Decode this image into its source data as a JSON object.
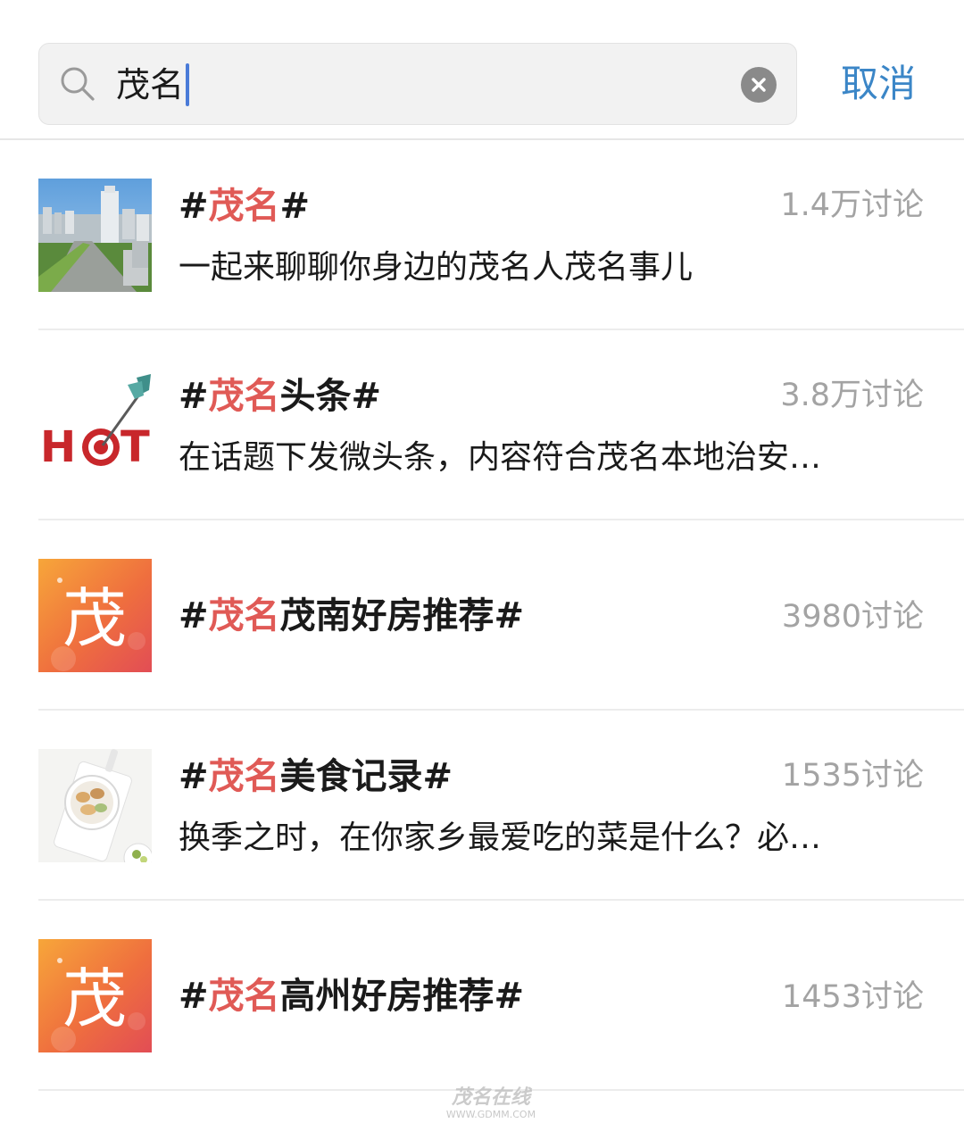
{
  "search": {
    "query": "茂名",
    "cancel_label": "取消"
  },
  "colors": {
    "keyword": "#e05a56",
    "cancel": "#3b86c7",
    "count": "#a3a3a3",
    "caret": "#4a7bd8"
  },
  "results": [
    {
      "prefix": "#",
      "keyword": "茂名",
      "rest": "#",
      "count": "1.4万讨论",
      "description": "一起来聊聊你身边的茂名人茂名事儿",
      "thumbnail": "city-skyline-image"
    },
    {
      "prefix": "#",
      "keyword": "茂名",
      "rest": "头条#",
      "count": "3.8万讨论",
      "description": "在话题下发微头条，内容符合茂名本地治安…",
      "thumbnail": "hot-target-image"
    },
    {
      "prefix": "#",
      "keyword": "茂名",
      "rest": "茂南好房推荐#",
      "count": "3980讨论",
      "description": "",
      "thumbnail": "mao-character-tile",
      "thumbnail_char": "茂"
    },
    {
      "prefix": "#",
      "keyword": "茂名",
      "rest": "美食记录#",
      "count": "1535讨论",
      "description": "换季之时，在你家乡最爱吃的菜是什么？必…",
      "thumbnail": "food-plate-image"
    },
    {
      "prefix": "#",
      "keyword": "茂名",
      "rest": "高州好房推荐#",
      "count": "1453讨论",
      "description": "",
      "thumbnail": "mao-character-tile",
      "thumbnail_char": "茂"
    }
  ],
  "watermark": {
    "main": "茂名在线",
    "url": "WWW.GDMM.COM"
  }
}
